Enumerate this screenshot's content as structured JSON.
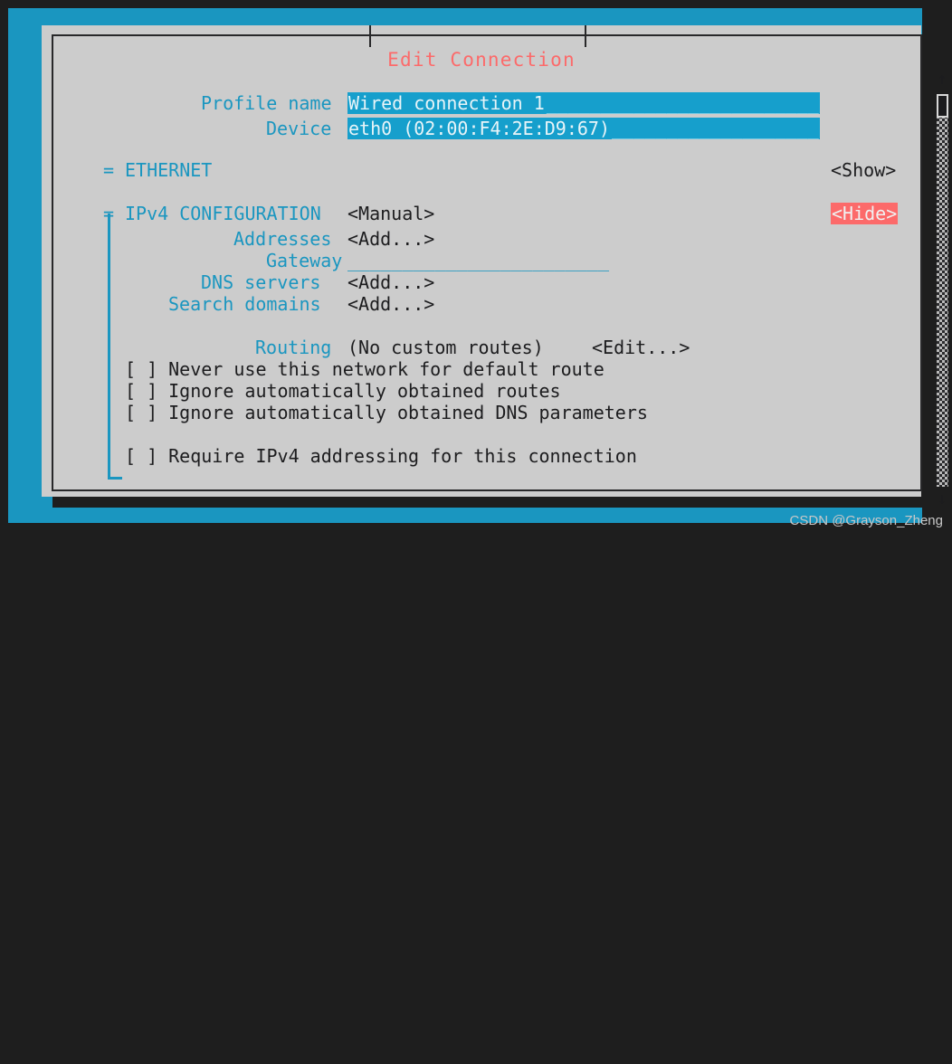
{
  "window": {
    "title": "Edit Connection",
    "title_color": "#fc6a6a",
    "background_color": "#1a96c0",
    "dialog_color": "#cccccc",
    "accent_cyan": "#1a96c0",
    "field_background": "#169fcc"
  },
  "form": {
    "profile_name": {
      "label": "Profile name",
      "value": "Wired connection 1",
      "underscores": "_________________________"
    },
    "device": {
      "label": "Device",
      "value": "eth0 (02:00:F4:2E:D9:67)",
      "underscores": "___________________"
    }
  },
  "sections": [
    {
      "marker": "=",
      "title": "ETHERNET",
      "toggle": "<Show>",
      "toggle_highlighted": false
    },
    {
      "marker": "=",
      "title": "IPv4 CONFIGURATION",
      "mode": "<Manual>",
      "toggle": "<Hide>",
      "toggle_highlighted": true
    }
  ],
  "ipv4": {
    "addresses": {
      "label": "Addresses",
      "value": "<Add...>"
    },
    "gateway": {
      "label": "Gateway",
      "value": "",
      "underline": "________________________"
    },
    "dns_servers": {
      "label": "DNS servers",
      "value": "<Add...>"
    },
    "search_domains": {
      "label": "Search domains",
      "value": "<Add...>"
    },
    "routing": {
      "label": "Routing",
      "status": "(No custom routes)",
      "edit": "<Edit...>"
    },
    "checkboxes": [
      {
        "box": "[ ]",
        "checked": false,
        "label": "Never use this network for default route"
      },
      {
        "box": "[ ]",
        "checked": false,
        "label": "Ignore automatically obtained routes"
      },
      {
        "box": "[ ]",
        "checked": false,
        "label": "Ignore automatically obtained DNS parameters"
      },
      {
        "box": "[ ]",
        "checked": false,
        "label": "Require IPv4 addressing for this connection"
      }
    ]
  },
  "scrollbar": {
    "up_arrow": "↑",
    "down_arrow": "↓",
    "thumb_position_percent": 0
  },
  "watermark": {
    "text": "CSDN @Grayson_Zheng"
  }
}
